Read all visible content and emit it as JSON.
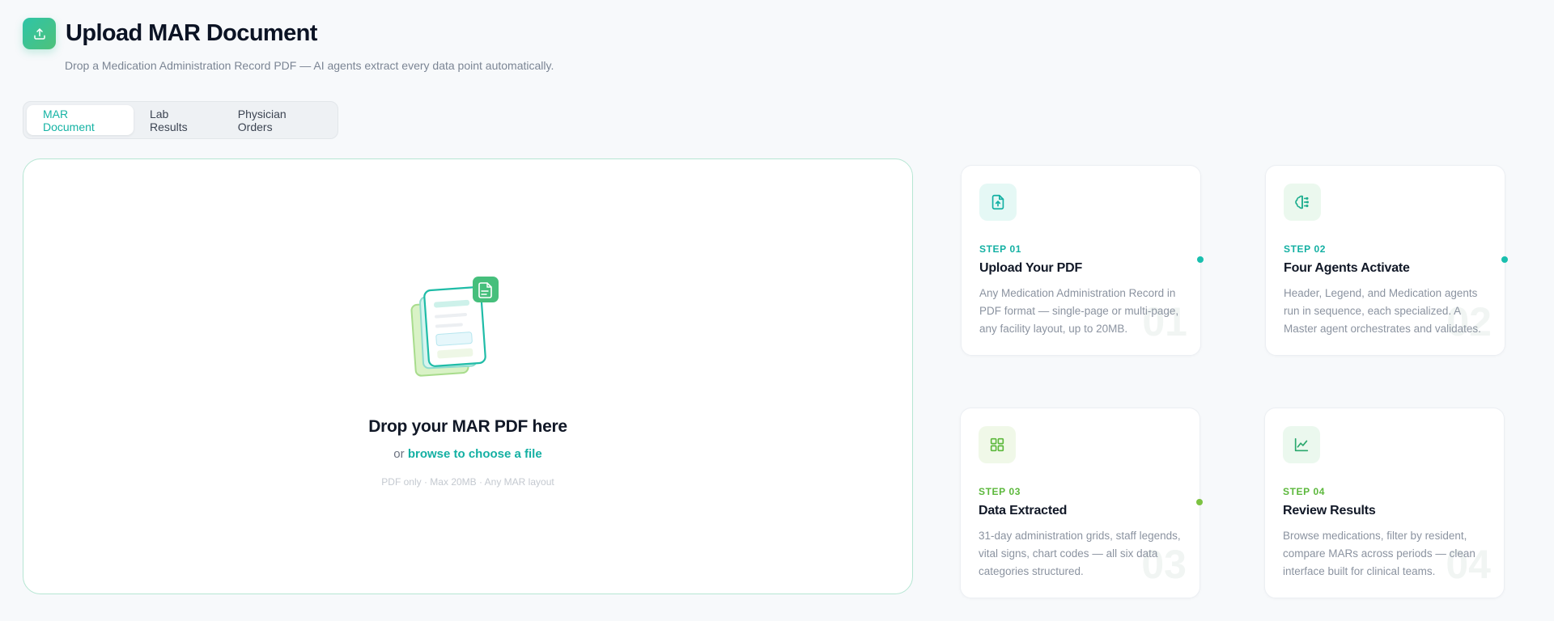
{
  "header": {
    "title": "Upload MAR Document",
    "subtitle": "Drop a Medication Administration Record PDF — AI agents extract every data point automatically."
  },
  "tabs": [
    {
      "label": "MAR Document",
      "active": true
    },
    {
      "label": "Lab Results",
      "active": false
    },
    {
      "label": "Physician Orders",
      "active": false
    }
  ],
  "dropzone": {
    "title": "Drop your MAR PDF here",
    "sub_prefix": "or",
    "browse_label": "browse to choose a file",
    "hint": "PDF only · Max 20MB · Any MAR layout"
  },
  "steps": [
    {
      "step": "STEP 01",
      "title": "Upload Your PDF",
      "description": "Any Medication Administration Record in PDF format — single-page or multi-page, any facility layout, up to 20MB.",
      "number": "01",
      "icon": "file-upload-icon"
    },
    {
      "step": "STEP 02",
      "title": "Four Agents Activate",
      "description": "Header, Legend, and Medication agents run in sequence, each specialized. A Master agent orchestrates and validates.",
      "number": "02",
      "icon": "brain-icon"
    },
    {
      "step": "STEP 03",
      "title": "Data Extracted",
      "description": "31-day administration grids, staff legends, vital signs, chart codes — all six data categories structured.",
      "number": "03",
      "icon": "grid-icon"
    },
    {
      "step": "STEP 04",
      "title": "Review Results",
      "description": "Browse medications, filter by resident, compare MARs across periods — clean interface built for clinical teams.",
      "number": "04",
      "icon": "line-chart-icon"
    }
  ],
  "colors": {
    "accent_teal": "#14b0a3",
    "accent_green": "#4fc27a",
    "accent_lime": "#5cb83c",
    "dropzone_border": "#b6e6d3"
  }
}
